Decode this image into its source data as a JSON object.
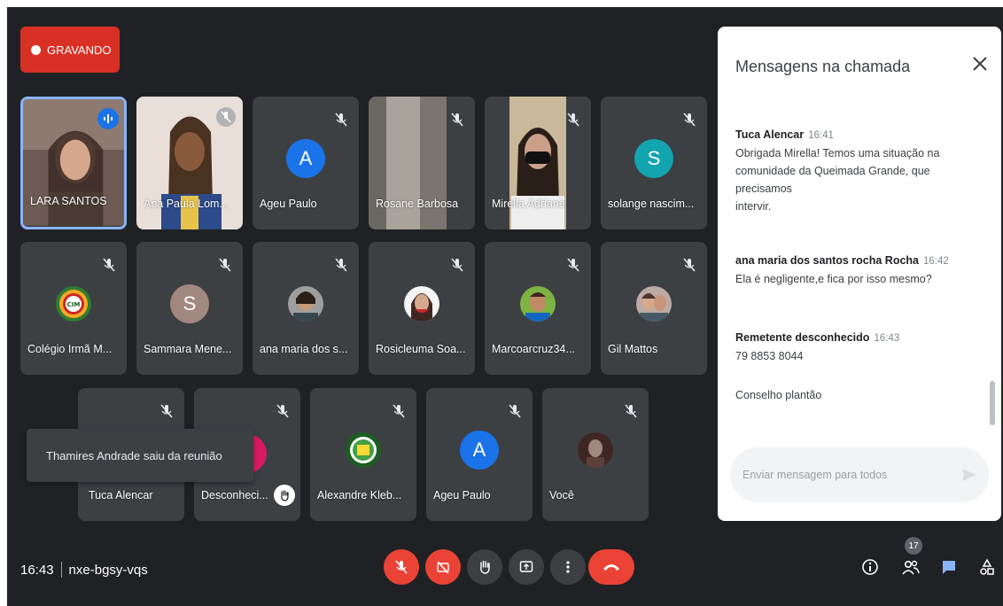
{
  "recording": {
    "label": "GRAVANDO"
  },
  "grid": {
    "row1": [
      {
        "name": "LARA SANTOS",
        "type": "video",
        "speaking": true
      },
      {
        "name": "Ana Paula Lom...",
        "type": "video"
      },
      {
        "name": "Ageu Paulo",
        "type": "avatar",
        "initial": "A",
        "color": "#1a73e8"
      },
      {
        "name": "Rosane Barbosa",
        "type": "video"
      },
      {
        "name": "Mirella Adriane",
        "type": "video"
      },
      {
        "name": "solange nascim...",
        "type": "avatar",
        "initial": "S",
        "color": "#12a4af"
      }
    ],
    "row2": [
      {
        "name": "Colégio Irmã M...",
        "type": "logo",
        "logo_text": "CIM"
      },
      {
        "name": "Sammara Mene...",
        "type": "avatar",
        "initial": "S",
        "color": "#a1887f"
      },
      {
        "name": "ana maria dos s...",
        "type": "photo"
      },
      {
        "name": "Rosicleuma Soa...",
        "type": "photo"
      },
      {
        "name": "Marcoarcruz34...",
        "type": "photo"
      },
      {
        "name": "Gil Mattos",
        "type": "photo"
      }
    ],
    "row3": [
      {
        "name": "Tuca Alencar",
        "type": "blank"
      },
      {
        "name": "Desconheci...",
        "type": "pink",
        "hand_raised": true
      },
      {
        "name": "Alexandre Kleb...",
        "type": "logo"
      },
      {
        "name": "Ageu Paulo",
        "type": "avatar",
        "initial": "A",
        "color": "#1a73e8"
      },
      {
        "name": "Você",
        "type": "photo"
      }
    ]
  },
  "toast": {
    "text": "Thamires Andrade saiu da reunião"
  },
  "footer": {
    "time": "16:43",
    "meeting_code": "nxe-bgsy-vqs",
    "participants_count": "17"
  },
  "controls": [
    "mic-off",
    "camera-off",
    "raise-hand",
    "present",
    "more",
    "leave-call"
  ],
  "chat": {
    "title": "Mensagens na chamada",
    "messages": [
      {
        "sender": "Tuca Alencar",
        "time": "16:41",
        "lines": [
          "Obrigada Mirella! Temos uma situação na",
          "comunidade da Queimada Grande, que precisamos",
          "intervir."
        ]
      },
      {
        "sender": "ana maria dos santos rocha Rocha",
        "time": "16:42",
        "lines": [
          "Ela é negligente,e fica por isso mesmo?"
        ]
      },
      {
        "sender": "Remetente desconhecido",
        "time": "16:43",
        "lines": [
          "79 8853 8044"
        ]
      },
      {
        "lines": [
          "Conselho plantão"
        ]
      }
    ],
    "input_placeholder": "Enviar mensagem para todos"
  },
  "colors": {
    "background": "#202124",
    "tile": "#3c4043",
    "danger": "#ea4335",
    "accent": "#8ab4f8"
  }
}
